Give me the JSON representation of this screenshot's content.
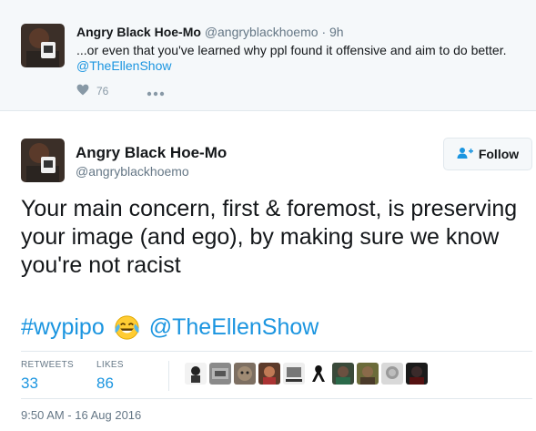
{
  "reply_tweet": {
    "name": "Angry Black Hoe-Mo",
    "handle": "@angryblackhoemo",
    "separator": "·",
    "time": "9h",
    "text": "...or even that you've learned why ppl found it offensive and aim to do better.",
    "mention": "@TheEllenShow",
    "likes": "76",
    "icons": {
      "like": "heart-icon",
      "more": "more-dots-icon"
    }
  },
  "main_tweet": {
    "name": "Angry Black Hoe-Mo",
    "handle": "@angryblackhoemo",
    "follow_label": "Follow",
    "text": "Your main concern, first & foremost, is preserving your image (and ego), by making sure we know you're not racist",
    "hashtag": "#wypipo",
    "emoji": "face-with-tears-of-joy",
    "mention": "@TheEllenShow",
    "stats": {
      "retweets_label": "RETWEETS",
      "retweets_value": "33",
      "likes_label": "LIKES",
      "likes_value": "86"
    },
    "likers_count_shown": 10,
    "timestamp": "9:50 AM - 16 Aug 2016"
  },
  "colors": {
    "link": "#1b95e0",
    "muted": "#657786",
    "border": "#e1e8ed",
    "reply_bg": "#f5f8fa"
  }
}
